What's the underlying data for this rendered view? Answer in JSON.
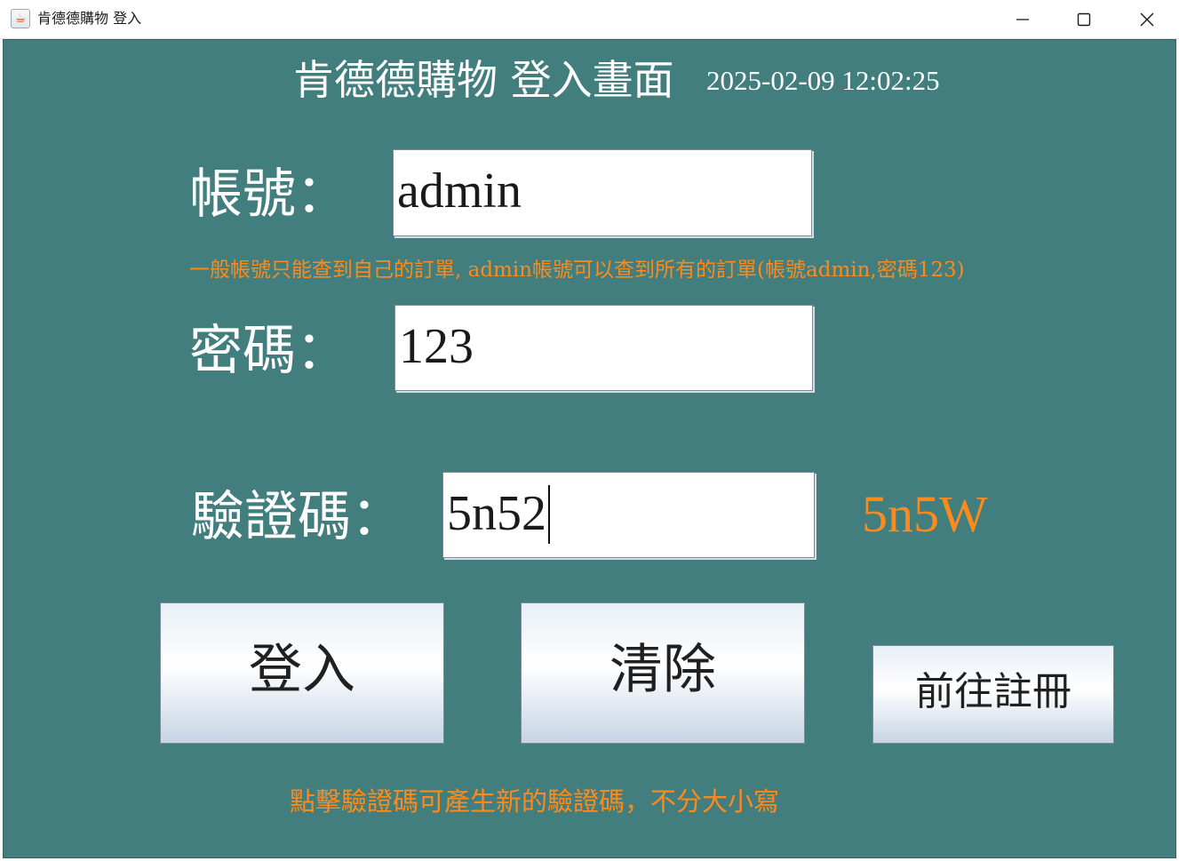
{
  "window": {
    "title": "肯德德購物 登入",
    "app_icon": "java-coffee-icon",
    "controls": [
      "minimize-icon",
      "maximize-icon",
      "close-icon"
    ]
  },
  "header": {
    "title": "肯德德購物 登入畫面",
    "datetime": "2025-02-09 12:02:25"
  },
  "form": {
    "account_label": "帳號：",
    "account_value": "admin",
    "account_hint": "一般帳號只能查到自己的訂單, admin帳號可以查到所有的訂單(帳號admin,密碼123)",
    "password_label": "密碼：",
    "password_value": "123",
    "captcha_label": "驗證碼：",
    "captcha_value": "5n52",
    "captcha_code": "5n5W"
  },
  "buttons": {
    "login": "登入",
    "clear": "清除",
    "register": "前往註冊"
  },
  "footer_hint": "點擊驗證碼可產生新的驗證碼，不分大小寫",
  "colors": {
    "background": "#417e7d",
    "accent_orange": "#ff8a1c",
    "text_white": "#ffffff"
  }
}
